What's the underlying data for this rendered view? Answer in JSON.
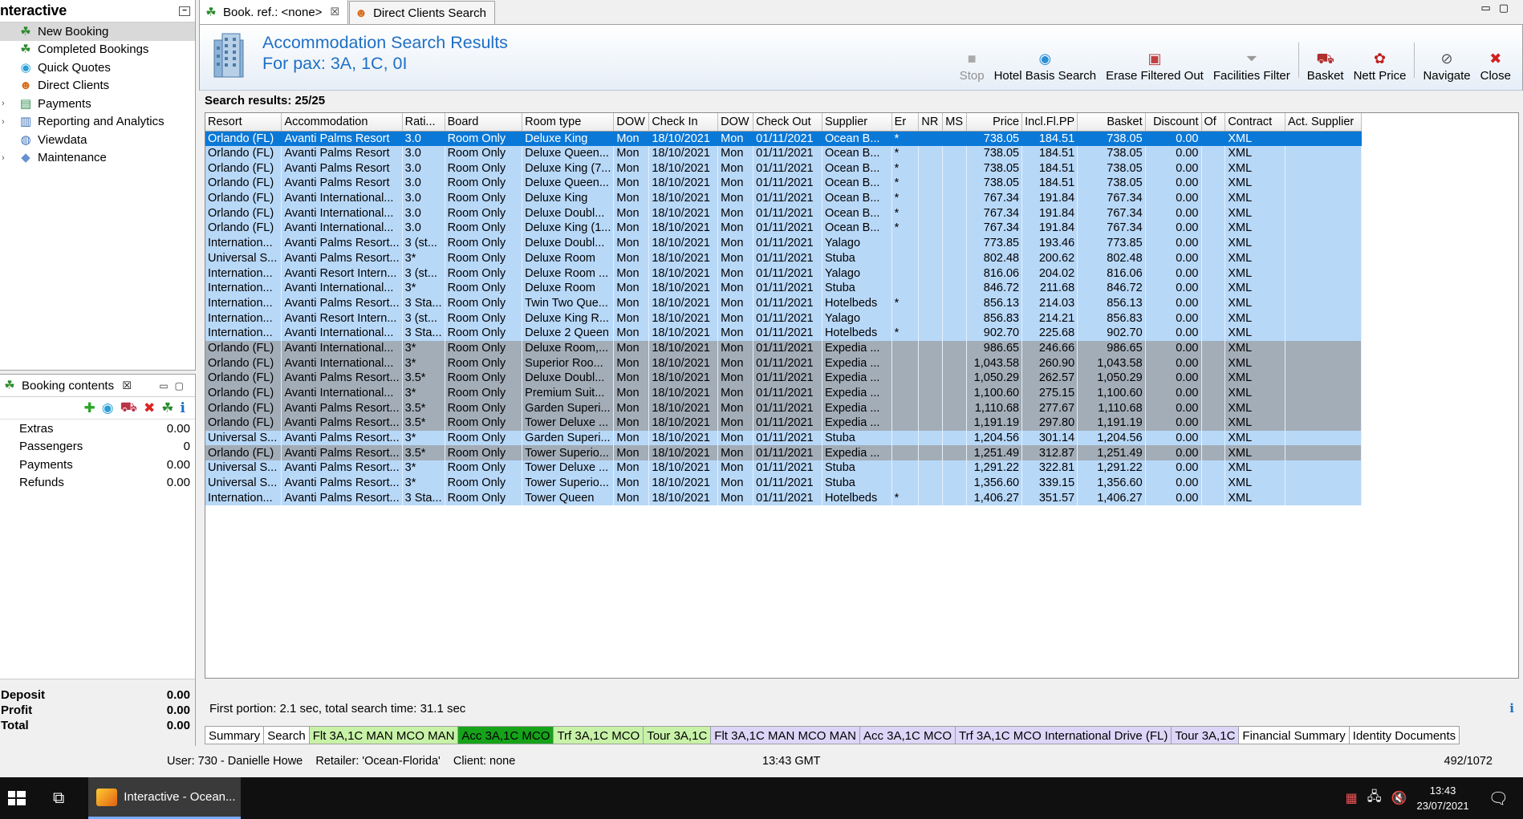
{
  "app": {
    "title": "nteractive",
    "nav": [
      {
        "label": "New Booking",
        "icon": "palm-tree-icon",
        "selected": true
      },
      {
        "label": "Completed Bookings",
        "icon": "palm-tree-icon"
      },
      {
        "label": "Quick Quotes",
        "icon": "refresh-globe-icon"
      },
      {
        "label": "Direct Clients",
        "icon": "client-person-icon"
      },
      {
        "label": "Payments",
        "icon": "money-icon",
        "expandable": true
      },
      {
        "label": "Reporting and Analytics",
        "icon": "report-icon",
        "expandable": true
      },
      {
        "label": "Viewdata",
        "icon": "globe-icon"
      },
      {
        "label": "Maintenance",
        "icon": "tools-icon",
        "expandable": true
      }
    ]
  },
  "booking": {
    "tab_label": "Booking contents",
    "rows": [
      {
        "label": "Extras",
        "value": "0.00"
      },
      {
        "label": "Passengers",
        "value": "0"
      },
      {
        "label": "Payments",
        "value": "0.00"
      },
      {
        "label": "Refunds",
        "value": "0.00"
      }
    ],
    "totals": [
      {
        "label": "Deposit",
        "value": "0.00"
      },
      {
        "label": "Profit",
        "value": "0.00"
      },
      {
        "label": "Total",
        "value": "0.00"
      }
    ]
  },
  "tabs": [
    {
      "label": "Book. ref.: <none>",
      "active": true,
      "closable": true
    },
    {
      "label": "Direct Clients Search",
      "active": false
    }
  ],
  "header": {
    "title_line1": "Accommodation Search Results",
    "title_line2": "For pax: 3A, 1C, 0I"
  },
  "toolbar": [
    {
      "label": "Stop",
      "icon": "stop-icon",
      "disabled": true
    },
    {
      "label": "Hotel Basis Search",
      "icon": "hotel-search-icon"
    },
    {
      "label": "Erase Filtered Out",
      "icon": "erase-filter-icon"
    },
    {
      "label": "Facilities Filter",
      "icon": "funnel-icon",
      "sep_after": true
    },
    {
      "label": "Basket",
      "icon": "basket-icon"
    },
    {
      "label": "Nett Price",
      "icon": "nett-price-icon",
      "sep_after": true
    },
    {
      "label": "Navigate",
      "icon": "navigate-icon"
    },
    {
      "label": "Close",
      "icon": "close-icon"
    }
  ],
  "results_label": "Search results: 25/25",
  "columns": [
    "Resort",
    "Accommodation",
    "Rati...",
    "Board",
    "Room type",
    "DOW",
    "Check In",
    "DOW",
    "Check Out",
    "Supplier",
    "Er",
    "NR",
    "MS",
    "Price",
    "Incl.Fl.PP",
    "Basket",
    "Discount",
    "Of",
    "Contract",
    "Act. Supplier"
  ],
  "rows": [
    [
      "Orlando (FL)",
      "Avanti Palms Resort",
      "3.0",
      "Room Only",
      "Deluxe King",
      "Mon",
      "18/10/2021",
      "Mon",
      "01/11/2021",
      "Ocean B...",
      "*",
      "",
      "",
      "738.05",
      "184.51",
      "738.05",
      "0.00",
      "",
      "XML",
      ""
    ],
    [
      "Orlando (FL)",
      "Avanti Palms Resort",
      "3.0",
      "Room Only",
      "Deluxe Queen...",
      "Mon",
      "18/10/2021",
      "Mon",
      "01/11/2021",
      "Ocean B...",
      "*",
      "",
      "",
      "738.05",
      "184.51",
      "738.05",
      "0.00",
      "",
      "XML",
      ""
    ],
    [
      "Orlando (FL)",
      "Avanti Palms Resort",
      "3.0",
      "Room Only",
      "Deluxe King (7...",
      "Mon",
      "18/10/2021",
      "Mon",
      "01/11/2021",
      "Ocean B...",
      "*",
      "",
      "",
      "738.05",
      "184.51",
      "738.05",
      "0.00",
      "",
      "XML",
      ""
    ],
    [
      "Orlando (FL)",
      "Avanti Palms Resort",
      "3.0",
      "Room Only",
      "Deluxe Queen...",
      "Mon",
      "18/10/2021",
      "Mon",
      "01/11/2021",
      "Ocean B...",
      "*",
      "",
      "",
      "738.05",
      "184.51",
      "738.05",
      "0.00",
      "",
      "XML",
      ""
    ],
    [
      "Orlando (FL)",
      "Avanti International...",
      "3.0",
      "Room Only",
      "Deluxe King",
      "Mon",
      "18/10/2021",
      "Mon",
      "01/11/2021",
      "Ocean B...",
      "*",
      "",
      "",
      "767.34",
      "191.84",
      "767.34",
      "0.00",
      "",
      "XML",
      ""
    ],
    [
      "Orlando (FL)",
      "Avanti International...",
      "3.0",
      "Room Only",
      "Deluxe Doubl...",
      "Mon",
      "18/10/2021",
      "Mon",
      "01/11/2021",
      "Ocean B...",
      "*",
      "",
      "",
      "767.34",
      "191.84",
      "767.34",
      "0.00",
      "",
      "XML",
      ""
    ],
    [
      "Orlando (FL)",
      "Avanti International...",
      "3.0",
      "Room Only",
      "Deluxe King (1...",
      "Mon",
      "18/10/2021",
      "Mon",
      "01/11/2021",
      "Ocean B...",
      "*",
      "",
      "",
      "767.34",
      "191.84",
      "767.34",
      "0.00",
      "",
      "XML",
      ""
    ],
    [
      "Internation...",
      "Avanti Palms Resort...",
      "3 (st...",
      "Room Only",
      "Deluxe Doubl...",
      "Mon",
      "18/10/2021",
      "Mon",
      "01/11/2021",
      "Yalago",
      "",
      "",
      "",
      "773.85",
      "193.46",
      "773.85",
      "0.00",
      "",
      "XML",
      ""
    ],
    [
      "Universal S...",
      "Avanti Palms Resort...",
      "3*",
      "Room Only",
      "Deluxe Room",
      "Mon",
      "18/10/2021",
      "Mon",
      "01/11/2021",
      "Stuba",
      "",
      "",
      "",
      "802.48",
      "200.62",
      "802.48",
      "0.00",
      "",
      "XML",
      ""
    ],
    [
      "Internation...",
      "Avanti Resort Intern...",
      "3 (st...",
      "Room Only",
      "Deluxe Room ...",
      "Mon",
      "18/10/2021",
      "Mon",
      "01/11/2021",
      "Yalago",
      "",
      "",
      "",
      "816.06",
      "204.02",
      "816.06",
      "0.00",
      "",
      "XML",
      ""
    ],
    [
      "Internation...",
      "Avanti International...",
      "3*",
      "Room Only",
      "Deluxe Room",
      "Mon",
      "18/10/2021",
      "Mon",
      "01/11/2021",
      "Stuba",
      "",
      "",
      "",
      "846.72",
      "211.68",
      "846.72",
      "0.00",
      "",
      "XML",
      ""
    ],
    [
      "Internation...",
      "Avanti Palms Resort...",
      "3 Sta...",
      "Room Only",
      "Twin Two Que...",
      "Mon",
      "18/10/2021",
      "Mon",
      "01/11/2021",
      "Hotelbeds",
      "*",
      "",
      "",
      "856.13",
      "214.03",
      "856.13",
      "0.00",
      "",
      "XML",
      ""
    ],
    [
      "Internation...",
      "Avanti Resort Intern...",
      "3 (st...",
      "Room Only",
      "Deluxe King R...",
      "Mon",
      "18/10/2021",
      "Mon",
      "01/11/2021",
      "Yalago",
      "",
      "",
      "",
      "856.83",
      "214.21",
      "856.83",
      "0.00",
      "",
      "XML",
      ""
    ],
    [
      "Internation...",
      "Avanti International...",
      "3 Sta...",
      "Room Only",
      "Deluxe 2 Queen",
      "Mon",
      "18/10/2021",
      "Mon",
      "01/11/2021",
      "Hotelbeds",
      "*",
      "",
      "",
      "902.70",
      "225.68",
      "902.70",
      "0.00",
      "",
      "XML",
      ""
    ],
    [
      "Orlando (FL)",
      "Avanti International...",
      "3*",
      "Room Only",
      "Deluxe Room,...",
      "Mon",
      "18/10/2021",
      "Mon",
      "01/11/2021",
      "Expedia ...",
      "",
      "",
      "",
      "986.65",
      "246.66",
      "986.65",
      "0.00",
      "",
      "XML",
      ""
    ],
    [
      "Orlando (FL)",
      "Avanti International...",
      "3*",
      "Room Only",
      "Superior Roo...",
      "Mon",
      "18/10/2021",
      "Mon",
      "01/11/2021",
      "Expedia ...",
      "",
      "",
      "",
      "1,043.58",
      "260.90",
      "1,043.58",
      "0.00",
      "",
      "XML",
      ""
    ],
    [
      "Orlando (FL)",
      "Avanti Palms Resort...",
      "3.5*",
      "Room Only",
      "Deluxe Doubl...",
      "Mon",
      "18/10/2021",
      "Mon",
      "01/11/2021",
      "Expedia ...",
      "",
      "",
      "",
      "1,050.29",
      "262.57",
      "1,050.29",
      "0.00",
      "",
      "XML",
      ""
    ],
    [
      "Orlando (FL)",
      "Avanti International...",
      "3*",
      "Room Only",
      "Premium Suit...",
      "Mon",
      "18/10/2021",
      "Mon",
      "01/11/2021",
      "Expedia ...",
      "",
      "",
      "",
      "1,100.60",
      "275.15",
      "1,100.60",
      "0.00",
      "",
      "XML",
      ""
    ],
    [
      "Orlando (FL)",
      "Avanti Palms Resort...",
      "3.5*",
      "Room Only",
      "Garden Superi...",
      "Mon",
      "18/10/2021",
      "Mon",
      "01/11/2021",
      "Expedia ...",
      "",
      "",
      "",
      "1,110.68",
      "277.67",
      "1,110.68",
      "0.00",
      "",
      "XML",
      ""
    ],
    [
      "Orlando (FL)",
      "Avanti Palms Resort...",
      "3.5*",
      "Room Only",
      "Tower Deluxe ...",
      "Mon",
      "18/10/2021",
      "Mon",
      "01/11/2021",
      "Expedia ...",
      "",
      "",
      "",
      "1,191.19",
      "297.80",
      "1,191.19",
      "0.00",
      "",
      "XML",
      ""
    ],
    [
      "Universal S...",
      "Avanti Palms Resort...",
      "3*",
      "Room Only",
      "Garden Superi...",
      "Mon",
      "18/10/2021",
      "Mon",
      "01/11/2021",
      "Stuba",
      "",
      "",
      "",
      "1,204.56",
      "301.14",
      "1,204.56",
      "0.00",
      "",
      "XML",
      ""
    ],
    [
      "Orlando (FL)",
      "Avanti Palms Resort...",
      "3.5*",
      "Room Only",
      "Tower Superio...",
      "Mon",
      "18/10/2021",
      "Mon",
      "01/11/2021",
      "Expedia ...",
      "",
      "",
      "",
      "1,251.49",
      "312.87",
      "1,251.49",
      "0.00",
      "",
      "XML",
      ""
    ],
    [
      "Universal S...",
      "Avanti Palms Resort...",
      "3*",
      "Room Only",
      "Tower Deluxe ...",
      "Mon",
      "18/10/2021",
      "Mon",
      "01/11/2021",
      "Stuba",
      "",
      "",
      "",
      "1,291.22",
      "322.81",
      "1,291.22",
      "0.00",
      "",
      "XML",
      ""
    ],
    [
      "Universal S...",
      "Avanti Palms Resort...",
      "3*",
      "Room Only",
      "Tower Superio...",
      "Mon",
      "18/10/2021",
      "Mon",
      "01/11/2021",
      "Stuba",
      "",
      "",
      "",
      "1,356.60",
      "339.15",
      "1,356.60",
      "0.00",
      "",
      "XML",
      ""
    ],
    [
      "Internation...",
      "Avanti Palms Resort...",
      "3 Sta...",
      "Room Only",
      "Tower Queen",
      "Mon",
      "18/10/2021",
      "Mon",
      "01/11/2021",
      "Hotelbeds",
      "*",
      "",
      "",
      "1,406.27",
      "351.57",
      "1,406.27",
      "0.00",
      "",
      "XML",
      ""
    ]
  ],
  "row_styles": [
    "selected",
    "light",
    "light",
    "light",
    "light",
    "light",
    "light",
    "light",
    "light",
    "light",
    "light",
    "light",
    "light",
    "light",
    "dark",
    "dark",
    "dark",
    "dark",
    "dark",
    "dark",
    "light",
    "dark",
    "light",
    "light",
    "light"
  ],
  "footer": {
    "timing": "First portion: 2.1 sec, total search time: 31.1 sec"
  },
  "bottom_tabs": [
    {
      "label": "Summary",
      "style": "plain"
    },
    {
      "label": "Search",
      "style": "plain"
    },
    {
      "label": "Flt 3A,1C MAN MCO MAN",
      "style": "green"
    },
    {
      "label": "Acc 3A,1C MCO",
      "style": "green-active"
    },
    {
      "label": "Trf 3A,1C MCO",
      "style": "green"
    },
    {
      "label": "Tour 3A,1C",
      "style": "green"
    },
    {
      "label": "Flt 3A,1C MAN MCO MAN",
      "style": "purple"
    },
    {
      "label": "Acc 3A,1C MCO",
      "style": "purple"
    },
    {
      "label": "Trf 3A,1C MCO International Drive (FL)",
      "style": "purple"
    },
    {
      "label": "Tour 3A,1C",
      "style": "purple"
    },
    {
      "label": "Financial Summary",
      "style": "plain"
    },
    {
      "label": "Identity Documents",
      "style": "plain"
    }
  ],
  "status": {
    "user": "User: 730 - Danielle Howe    Retailer: 'Ocean-Florida'    Client: none",
    "time": "13:43 GMT",
    "count": "492/1072"
  },
  "taskbar": {
    "app_label": "Interactive - Ocean...",
    "clock_time": "13:43",
    "clock_date": "23/07/2021"
  },
  "colors": {
    "row_light": "#b8d8f8",
    "row_dark": "#a3adb8",
    "row_selected": "#0a78d7",
    "title_blue": "#1f6fc5"
  }
}
